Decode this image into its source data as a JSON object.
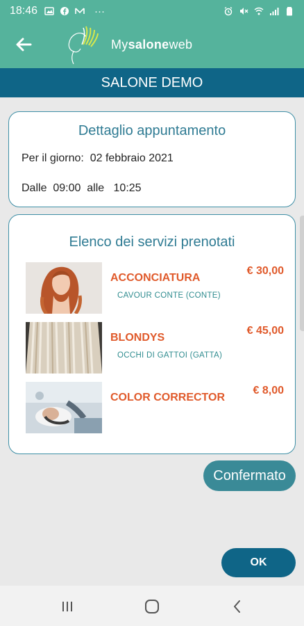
{
  "status_bar": {
    "time": "18:46",
    "dots": "···"
  },
  "header": {
    "logo_my": "My",
    "logo_salone": "salone",
    "logo_web": "web"
  },
  "title_bar": {
    "title": "SALONE DEMO"
  },
  "detail_card": {
    "title": "Dettaglio appuntamento",
    "date_line": "Per il giorno:  02 febbraio 2021",
    "time_line": "Dalle  09:00  alle   10:25"
  },
  "services_card": {
    "title": "Elenco dei servizi prenotati",
    "items": [
      {
        "name": "ACCONCIATURA",
        "staff": "CAVOUR  CONTE (CONTE)",
        "price": "€ 30,00"
      },
      {
        "name": "BLONDYS",
        "staff": "OCCHI  DI GATTOI (GATTA)",
        "price": "€ 45,00"
      },
      {
        "name": "COLOR CORRECTOR",
        "staff": "",
        "price": "€ 8,00"
      }
    ]
  },
  "buttons": {
    "confirmed": "Confermato",
    "ok": "OK"
  },
  "colors": {
    "header_green": "#55b39c",
    "title_blue": "#0f6587",
    "accent_orange": "#e05a2b",
    "card_border": "#3d8ea5"
  }
}
